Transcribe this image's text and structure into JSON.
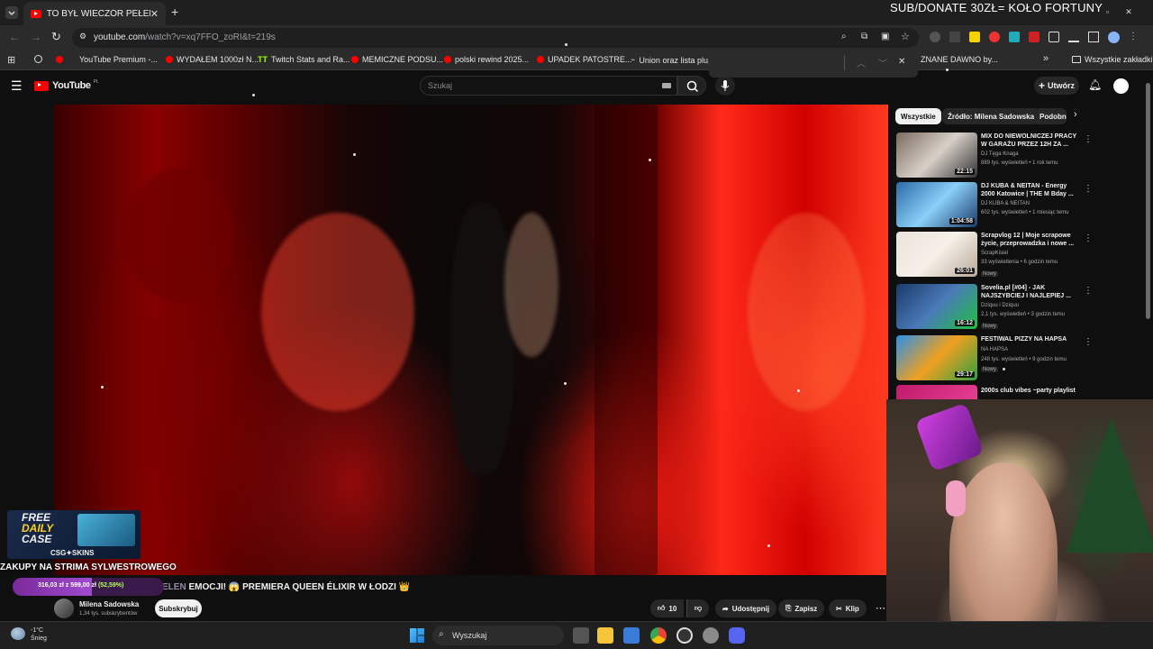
{
  "overlay": {
    "donate_text": "SUB/DONATE 30ZŁ= KOŁO FORTUNY",
    "promo_line1": "FREE",
    "promo_line2": "DAILY",
    "promo_line3": "CASE",
    "promo_brand": "CSG✦SKINS",
    "ticker": "ZAKUPY NA STRIMA SYLWESTROWEGO",
    "progress_text_a": "316,03 zł z 599,00 zł",
    "progress_text_b": "(52,59%)",
    "progress_fraction": 0.5259,
    "video_title_hidden": "ELEN",
    "video_title": "EMOCJI! 😱 PREMIERA QUEEN ÉLIXIR W ŁODZI 👑"
  },
  "browser": {
    "tab_title": "TO BYŁ WIECZÓR PEŁEN EMOC",
    "url_host": "youtube.com",
    "url_path": "/watch?v=xq7FFO_zoRI&t=219s",
    "bookmarks": [
      {
        "label": "YouTube Premium -..."
      },
      {
        "label": "WYDAŁEM 1000zł N..."
      },
      {
        "label": "Twitch Stats and Ra..."
      },
      {
        "label": "MEMICZNE PODSU..."
      },
      {
        "label": "polski rewind 2025..."
      },
      {
        "label": "UPADEK PATOSTRE..."
      },
      {
        "label": "Union oraz lista plu..."
      },
      {
        "label": "ZNANE DAWNO by..."
      }
    ],
    "all_bookmarks": "Wszystkie zakładki"
  },
  "youtube": {
    "logo": "YouTube",
    "logo_suffix": "PL",
    "search_placeholder": "Szukaj",
    "create_label": "Utwórz",
    "chips": [
      "Wszystkie",
      "Źródło: Milena Sadowska",
      "Podobne"
    ],
    "recommendations": [
      {
        "title": "MIX DO NIEWOLNICZEJ PRACY W GARAŻU PRZEZ 12H ZA ...",
        "channel": "DJ Tęga Knaga",
        "meta": "889 tys. wyświetleń • 1 rok temu",
        "duration": "22:15",
        "badge": ""
      },
      {
        "title": "DJ KUBA & NEITAN - Energy 2000 Katowice | THE M Bday ...",
        "channel": "DJ KUBA & NEITAN",
        "meta": "602 tys. wyświetleń • 1 miesiąc temu",
        "duration": "1:04:58",
        "badge": ""
      },
      {
        "title": "Scrapvlog 12 | Moje scrapowe życie, przeprowadzka i nowe ...",
        "channel": "ScrapKisiel",
        "meta": "33 wyświetlenia • 6 godzin temu",
        "duration": "26:01",
        "badge": "Nowy"
      },
      {
        "title": "Sovelia.pl [#04] - JAK NAJSZYBCIEJ I NAJLEPIEJ ...",
        "channel": "Dziquu i Dziquu",
        "meta": "2,1 tys. wyświetleń • 3 godzin temu",
        "duration": "16:12",
        "badge": "Nowy"
      },
      {
        "title": "FESTIWAL PIZZY NA HAPSA",
        "channel": "NA HAPSA",
        "meta": "248 tys. wyświetleń • 9 godzin temu",
        "duration": "29:17",
        "badge": "Nowy"
      },
      {
        "title": "2000s club vibes ~party playlist",
        "channel": "",
        "meta": "",
        "duration": "",
        "badge": ""
      }
    ],
    "channel_name": "Milena Sadowska",
    "channel_subs": "1,34 tys. subskrybentów",
    "subscribe_label": "Subskrybuj",
    "like_count": "10",
    "share_label": "Udostępnij",
    "save_label": "Zapisz",
    "clip_label": "Klip"
  },
  "taskbar": {
    "temp": "-1°C",
    "weather_label": "Śnieg",
    "search_label": "Wyszukaj"
  },
  "colors": {
    "yt_red": "#ff0000",
    "progress_green": "#b6ff5a"
  }
}
